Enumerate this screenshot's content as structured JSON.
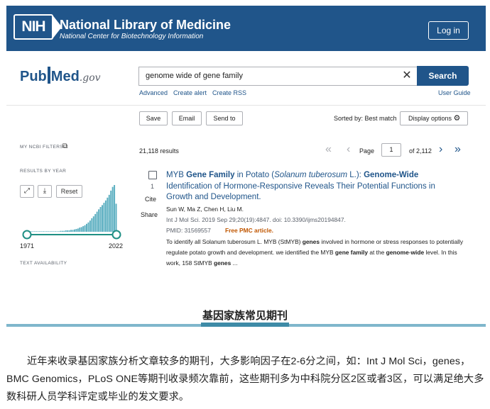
{
  "header": {
    "nih_logo": "NIH",
    "title": "National Library of Medicine",
    "subtitle": "National Center for Biotechnology Information",
    "login": "Log in"
  },
  "logo": {
    "pub": "Pub",
    "med": "Med",
    "gov": ".gov"
  },
  "search": {
    "value": "genome wide of gene family",
    "button": "Search",
    "links": {
      "advanced": "Advanced",
      "create_alert": "Create alert",
      "create_rss": "Create RSS",
      "user_guide": "User Guide"
    }
  },
  "actions": {
    "save": "Save",
    "email": "Email",
    "send_to": "Send to",
    "sorted_by": "Sorted by: Best match",
    "display_options": "Display options"
  },
  "sidebar": {
    "filters": "MY NCBI FILTERS",
    "results_by_year": "RESULTS BY YEAR",
    "reset": "Reset",
    "year_start": "1971",
    "year_end": "2022",
    "text_availability": "TEXT AVAILABILITY"
  },
  "results": {
    "count": "21,118 results",
    "page_label": "Page",
    "page": "1",
    "of_pages": "of 2,112"
  },
  "article": {
    "number": "1",
    "cite": "Cite",
    "share": "Share",
    "title_html": "MYB <b>Gene Family</b> in Potato (<i>Solanum tuberosum</i> L.): <b>Genome-Wide</b> Identification of Hormone-Responsive Reveals Their Potential Functions in Growth and Development.",
    "authors": "Sun W, Ma Z, Chen H, Liu M.",
    "journal": "Int J Mol Sci. 2019 Sep 29;20(19):4847. doi: 10.3390/ijms20194847.",
    "pmid": "PMID: 31569557",
    "free": "Free PMC article.",
    "snippet_html": "To identify all Solanum tuberosum L. MYB (StMYB) <b>genes</b> involved in hormone or stress responses to potentially regulate potato growth and development. we identified the MYB <b>gene family</b> at the <b>genome</b>-<b>wide</b> level. In this work, 158 StMYB <b>genes</b> ..."
  },
  "section_title": "基因家族常见期刊",
  "paragraph": "近年来收录基因家族分析文章较多的期刊，大多影响因子在2-6分之间，如：Int J Mol Sci，genes，BMC Genomics，PLoS ONE等期刊收录频次靠前，这些期刊多为中科院分区2区或者3区，可以满足绝大多数科研人员学科评定或毕业的发文要求。",
  "chart_data": {
    "type": "bar",
    "x_range": [
      "1971",
      "2022"
    ],
    "values": [
      0.01,
      0.01,
      0.01,
      0.01,
      0.01,
      0.01,
      0.01,
      0.01,
      0.01,
      0.01,
      0.01,
      0.01,
      0.01,
      0.01,
      0.01,
      0.01,
      0.01,
      0.01,
      0.01,
      0.02,
      0.02,
      0.02,
      0.03,
      0.03,
      0.03,
      0.04,
      0.04,
      0.05,
      0.06,
      0.07,
      0.09,
      0.1,
      0.12,
      0.14,
      0.17,
      0.2,
      0.24,
      0.29,
      0.33,
      0.38,
      0.43,
      0.48,
      0.53,
      0.57,
      0.62,
      0.67,
      0.73,
      0.79,
      0.88,
      0.96,
      1.0,
      0.6
    ],
    "color": "#5aaec0",
    "handle_color": "#1f8f84"
  },
  "colors": {
    "brand": "#20558a",
    "accent": "#3e8ba7",
    "free": "#c05600"
  }
}
